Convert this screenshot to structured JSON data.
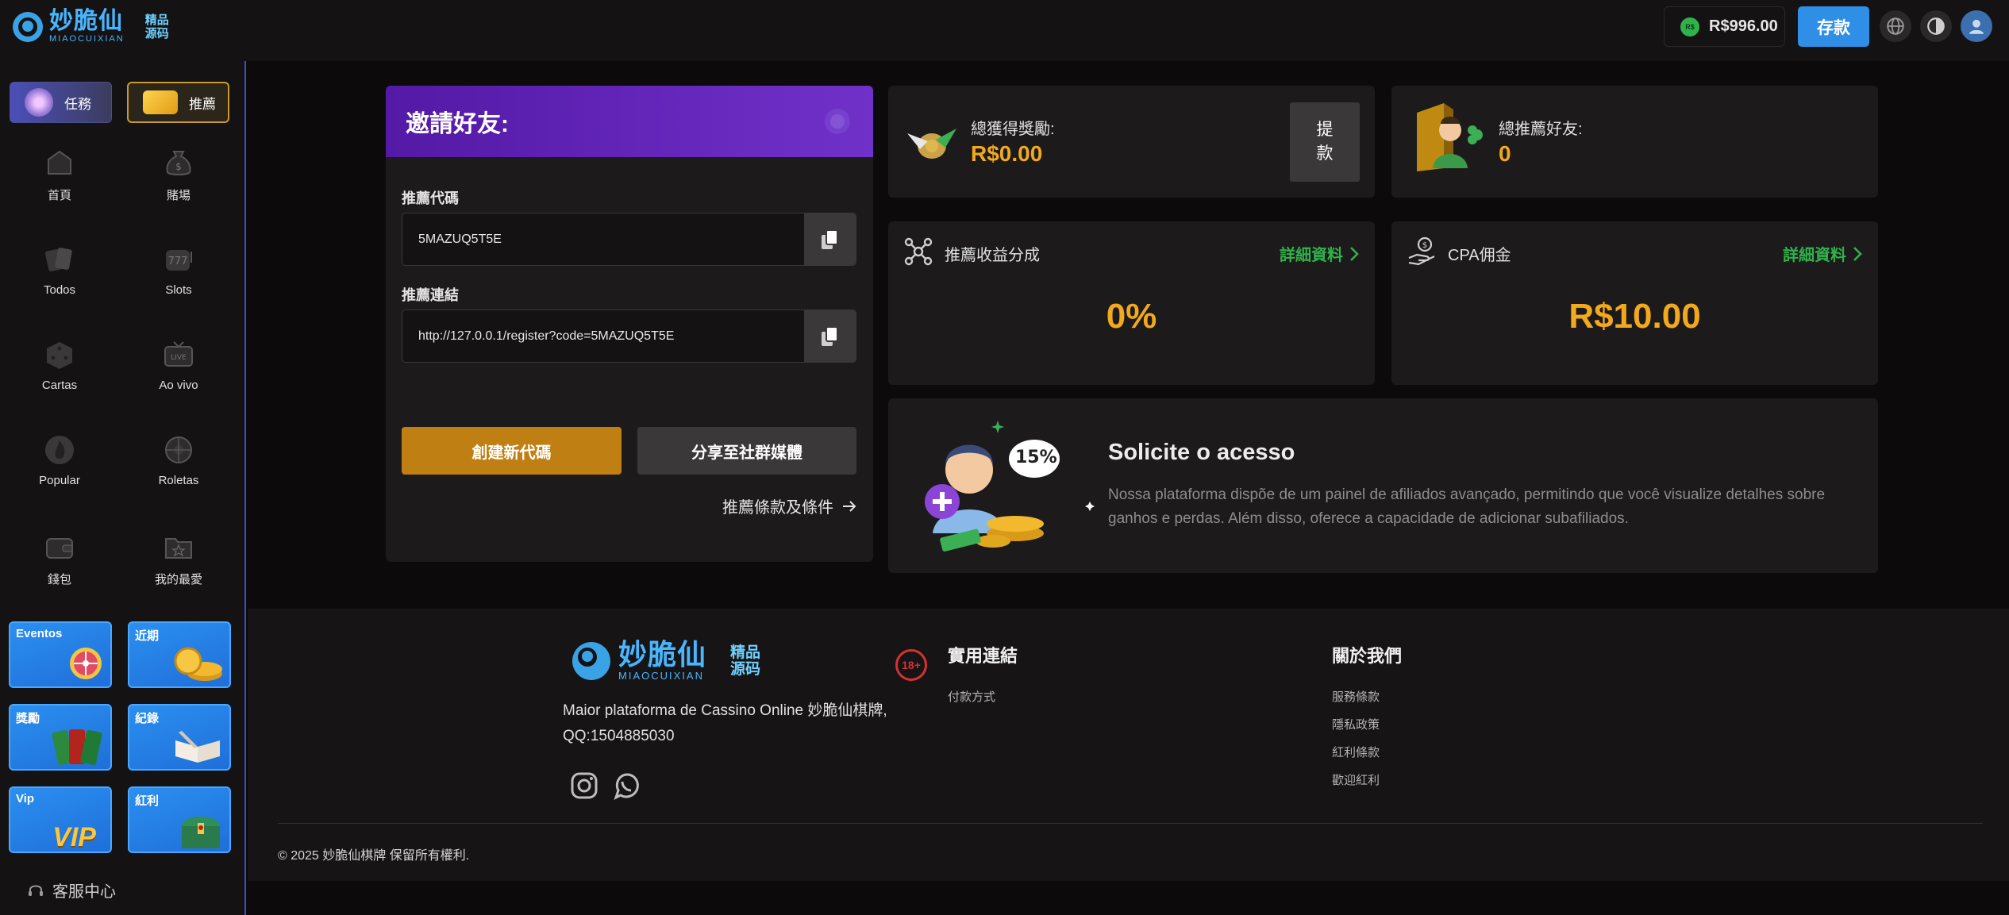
{
  "header": {
    "logo_title": "妙脆仙",
    "logo_sub": "MIAOCUIXIAN",
    "logo_badge": [
      "精品",
      "源码"
    ],
    "currency_badge": "R$",
    "balance": "R$996.00",
    "deposit_label": "存款"
  },
  "sidebar": {
    "top_buttons": [
      {
        "label": "任務"
      },
      {
        "label": "推薦"
      }
    ],
    "nav": [
      {
        "label": "首頁",
        "icon": "home-icon"
      },
      {
        "label": "賭場",
        "icon": "money-bag-icon"
      },
      {
        "label": "Todos",
        "icon": "cards-icon"
      },
      {
        "label": "Slots",
        "icon": "slot-machine-icon"
      },
      {
        "label": "Cartas",
        "icon": "dice-icon"
      },
      {
        "label": "Ao vivo",
        "icon": "live-tv-icon"
      },
      {
        "label": "Popular",
        "icon": "flame-icon"
      },
      {
        "label": "Roletas",
        "icon": "roulette-icon"
      },
      {
        "label": "錢包",
        "icon": "wallet-icon"
      },
      {
        "label": "我的最愛",
        "icon": "favorite-folder-icon"
      }
    ],
    "promos": [
      {
        "label": "Eventos"
      },
      {
        "label": "近期"
      },
      {
        "label": "獎勵"
      },
      {
        "label": "紀錄"
      },
      {
        "label": "Vip"
      },
      {
        "label": "紅利"
      }
    ],
    "vip_art_text": "VIP",
    "service_label": "客服中心"
  },
  "invite": {
    "title": "邀請好友:",
    "code_label": "推薦代碼",
    "code_value": "5MAZUQ5T5E",
    "link_label": "推薦連結",
    "link_value": "http://127.0.0.1/register?code=5MAZUQ5T5E",
    "create_code_label": "創建新代碼",
    "share_label": "分享至社群媒體",
    "terms_label": "推薦條款及條件"
  },
  "stats": {
    "total_reward_label": "總獲得獎勵:",
    "total_reward_value": "R$0.00",
    "withdraw_label": "提款",
    "total_friends_label": "總推薦好友:",
    "total_friends_value": "0",
    "revenue_share_label": "推薦收益分成",
    "revenue_share_value": "0%",
    "cpa_label": "CPA佣金",
    "cpa_value": "R$10.00",
    "details_label": "詳細資料"
  },
  "solicit": {
    "badge": "15%",
    "title": "Solicite o acesso",
    "text": "Nossa plataforma dispõe de um painel de afiliados avançado, permitindo que você visualize detalhes sobre ganhos e perdas. Além disso, oferece a capacidade de adicionar subafiliados."
  },
  "footer": {
    "desc_line1": "Maior plataforma de Cassino Online 妙脆仙棋牌,",
    "desc_line2": "QQ:1504885030",
    "age_badge": "18+",
    "useful_links_heading": "實用連結",
    "useful_links": [
      "付款方式"
    ],
    "about_heading": "關於我們",
    "about_links": [
      "服務條款",
      "隱私政策",
      "紅利條款",
      "歡迎紅利"
    ],
    "copyright": "© 2025 妙脆仙棋牌 保留所有權利."
  },
  "colors": {
    "accent_blue": "#2f8ee6",
    "gold": "#f2a91c",
    "green": "#2fb24b",
    "purple": "#6428b8"
  }
}
